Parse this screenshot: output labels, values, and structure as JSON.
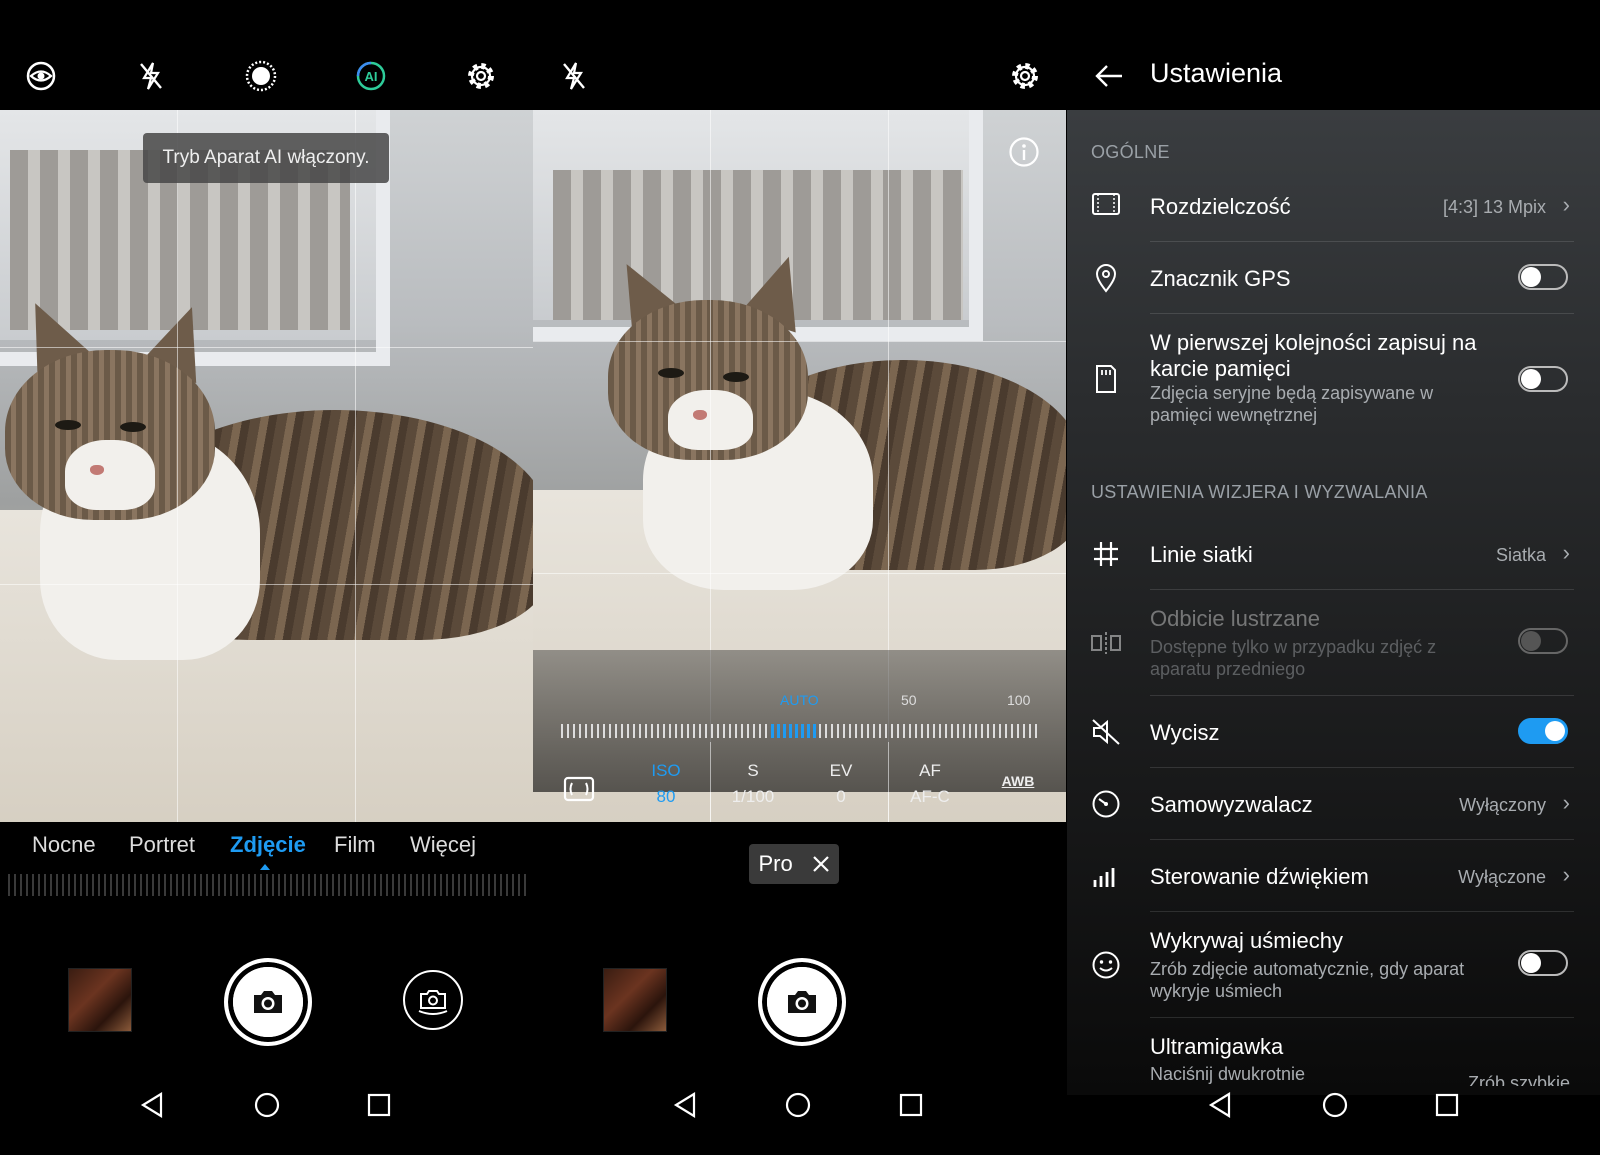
{
  "colors": {
    "accent": "#1e9bf2",
    "background": "#000000"
  },
  "screen1": {
    "top_icons": [
      "eye-icon",
      "flash-off-icon",
      "aperture-icon",
      "ai-icon",
      "gear-icon"
    ],
    "ai_label": "AI",
    "toast": "Tryb Aparat AI włączony.",
    "modes": [
      "Nocne",
      "Portret",
      "Zdjęcie",
      "Film",
      "Więcej"
    ],
    "active_mode": "Zdjęcie"
  },
  "screen2": {
    "top_icons": [
      "flash-off-icon",
      "gear-icon"
    ],
    "scale": {
      "auto": "AUTO",
      "mid": "50",
      "max": "100"
    },
    "pro_items": [
      {
        "label": "ISO",
        "value": "80",
        "active": true
      },
      {
        "label": "S",
        "value": "1/100"
      },
      {
        "label": "EV",
        "value": "0"
      },
      {
        "label": "AF",
        "value": "AF-C"
      },
      {
        "label": "AWB",
        "value": ""
      }
    ],
    "mode_badge": "Pro"
  },
  "screen3": {
    "title": "Ustawienia",
    "section_general": "OGÓLNE",
    "section_viewfinder": "USTAWIENIA WIZJERA I WYZWALANIA",
    "rows": {
      "resolution": {
        "label": "Rozdzielczość",
        "value": "[4:3] 13 Mpix"
      },
      "gps": {
        "label": "Znacznik GPS",
        "enabled": false
      },
      "sdcard": {
        "label": "W pierwszej kolejności zapisuj na karcie pamięci",
        "sub": "Zdjęcia seryjne będą zapisywane w pamięci wewnętrznej",
        "enabled": false
      },
      "grid": {
        "label": "Linie siatki",
        "value": "Siatka"
      },
      "mirror": {
        "label": "Odbicie lustrzane",
        "sub": "Dostępne tylko w przypadku zdjęć z aparatu przedniego",
        "enabled": false
      },
      "mute": {
        "label": "Wycisz",
        "enabled": true
      },
      "timer": {
        "label": "Samowyzwalacz",
        "value": "Wyłączony"
      },
      "sound": {
        "label": "Sterowanie dźwiękiem",
        "value": "Wyłączone"
      },
      "smile": {
        "label": "Wykrywaj uśmiechy",
        "sub": "Zrób zdjęcie automatycznie, gdy aparat wykryje uśmiech",
        "enabled": false
      },
      "ultra": {
        "label": "Ultramigawka",
        "sub": "Naciśnij dwukrotnie",
        "value": "Zrób szybkie"
      }
    }
  },
  "navbar": [
    "back-triangle-icon",
    "home-circle-icon",
    "recents-square-icon"
  ]
}
